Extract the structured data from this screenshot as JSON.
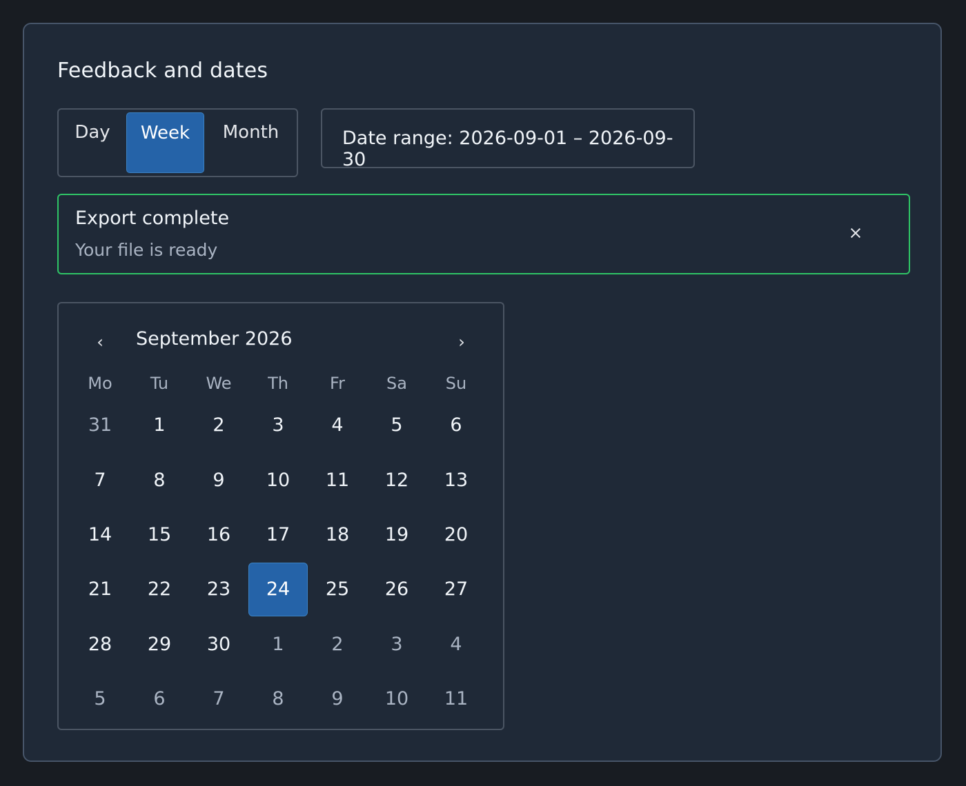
{
  "panel": {
    "title": "Feedback and dates"
  },
  "view_toggle": {
    "options": [
      "Day",
      "Week",
      "Month"
    ],
    "selected": "Week"
  },
  "date_range": {
    "label": "Date range: 2026-09-01 – 2026-09-30"
  },
  "toast": {
    "title": "Export complete",
    "message": "Your file is ready",
    "close_icon": "close-icon",
    "border_color": "#2fc466"
  },
  "calendar": {
    "month_label": "September 2026",
    "prev_icon": "‹",
    "next_icon": "›",
    "weekdays": [
      "Mo",
      "Tu",
      "We",
      "Th",
      "Fr",
      "Sa",
      "Su"
    ],
    "selected_day": "24",
    "weeks": [
      [
        "31",
        "1",
        "2",
        "3",
        "4",
        "5",
        "6"
      ],
      [
        "7",
        "8",
        "9",
        "10",
        "11",
        "12",
        "13"
      ],
      [
        "14",
        "15",
        "16",
        "17",
        "18",
        "19",
        "20"
      ],
      [
        "21",
        "22",
        "23",
        "24",
        "25",
        "26",
        "27"
      ],
      [
        "28",
        "29",
        "30",
        "1",
        "2",
        "3",
        "4"
      ],
      [
        "5",
        "6",
        "7",
        "8",
        "9",
        "10",
        "11"
      ]
    ]
  },
  "colors": {
    "accent": "#2563a8",
    "background": "#1f2937",
    "success": "#2fc466"
  }
}
